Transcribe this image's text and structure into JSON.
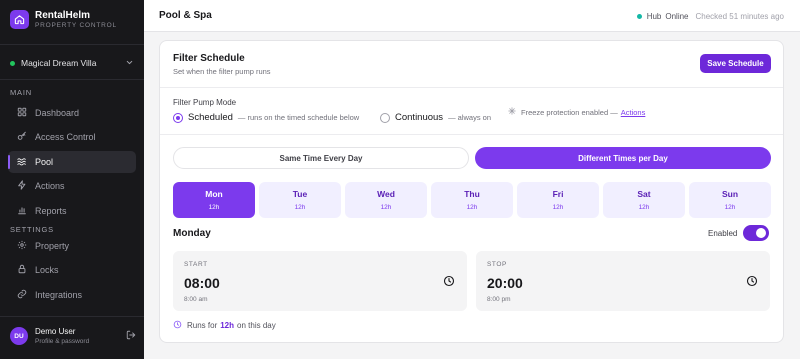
{
  "brand": {
    "name": "RentalHelm",
    "subtitle": "PROPERTY CONTROL"
  },
  "property_selector": {
    "value": "Magical Dream Villa"
  },
  "sidebar": {
    "main_label": "MAIN",
    "settings_label": "SETTINGS",
    "main_items": [
      {
        "label": "Dashboard",
        "icon": "grid-icon"
      },
      {
        "label": "Access Control",
        "icon": "key-icon"
      },
      {
        "label": "Pool",
        "icon": "waves-icon",
        "active": true
      },
      {
        "label": "Actions",
        "icon": "lightning-icon"
      },
      {
        "label": "Reports",
        "icon": "bar-chart-icon"
      }
    ],
    "settings_items": [
      {
        "label": "Property",
        "icon": "gear-icon"
      },
      {
        "label": "Locks",
        "icon": "lock-icon"
      },
      {
        "label": "Integrations",
        "icon": "link-icon"
      }
    ]
  },
  "user": {
    "initials": "DU",
    "name": "Demo User",
    "subtitle": "Profile & password"
  },
  "header": {
    "title": "Pool & Spa",
    "hub_label": "Hub",
    "hub_status": "Online",
    "checked": "Checked 51 minutes ago"
  },
  "filter": {
    "title": "Filter Schedule",
    "subtitle": "Set when the filter pump runs",
    "save_label": "Save Schedule",
    "mode_label": "Filter Pump Mode",
    "modes": [
      {
        "label": "Scheduled",
        "hint": "— runs on the timed schedule below",
        "checked": true
      },
      {
        "label": "Continuous",
        "hint": "— always on",
        "checked": false
      }
    ],
    "freeze_text": "Freeze protection enabled —",
    "freeze_link": "Actions",
    "schedule_options": [
      "Same Time Every Day",
      "Different Times per Day"
    ],
    "selected_option": 1,
    "days": [
      {
        "name": "Mon",
        "hours": "12h"
      },
      {
        "name": "Tue",
        "hours": "12h"
      },
      {
        "name": "Wed",
        "hours": "12h"
      },
      {
        "name": "Thu",
        "hours": "12h"
      },
      {
        "name": "Fri",
        "hours": "12h"
      },
      {
        "name": "Sat",
        "hours": "12h"
      },
      {
        "name": "Sun",
        "hours": "12h"
      }
    ],
    "selected_day": "Monday",
    "enabled_label": "Enabled",
    "enabled": true,
    "start": {
      "label": "START",
      "value": "08:00",
      "sub": "8:00 am"
    },
    "stop": {
      "label": "STOP",
      "value": "20:00",
      "sub": "8:00 pm"
    },
    "runs_prefix": "Runs for",
    "runs_hours": "12h",
    "runs_suffix": "on this day"
  },
  "colors": {
    "accent": "#7c3aed",
    "sidebar_bg": "#18181b",
    "online": "#14b8a6",
    "property_dot": "#22c55e"
  }
}
